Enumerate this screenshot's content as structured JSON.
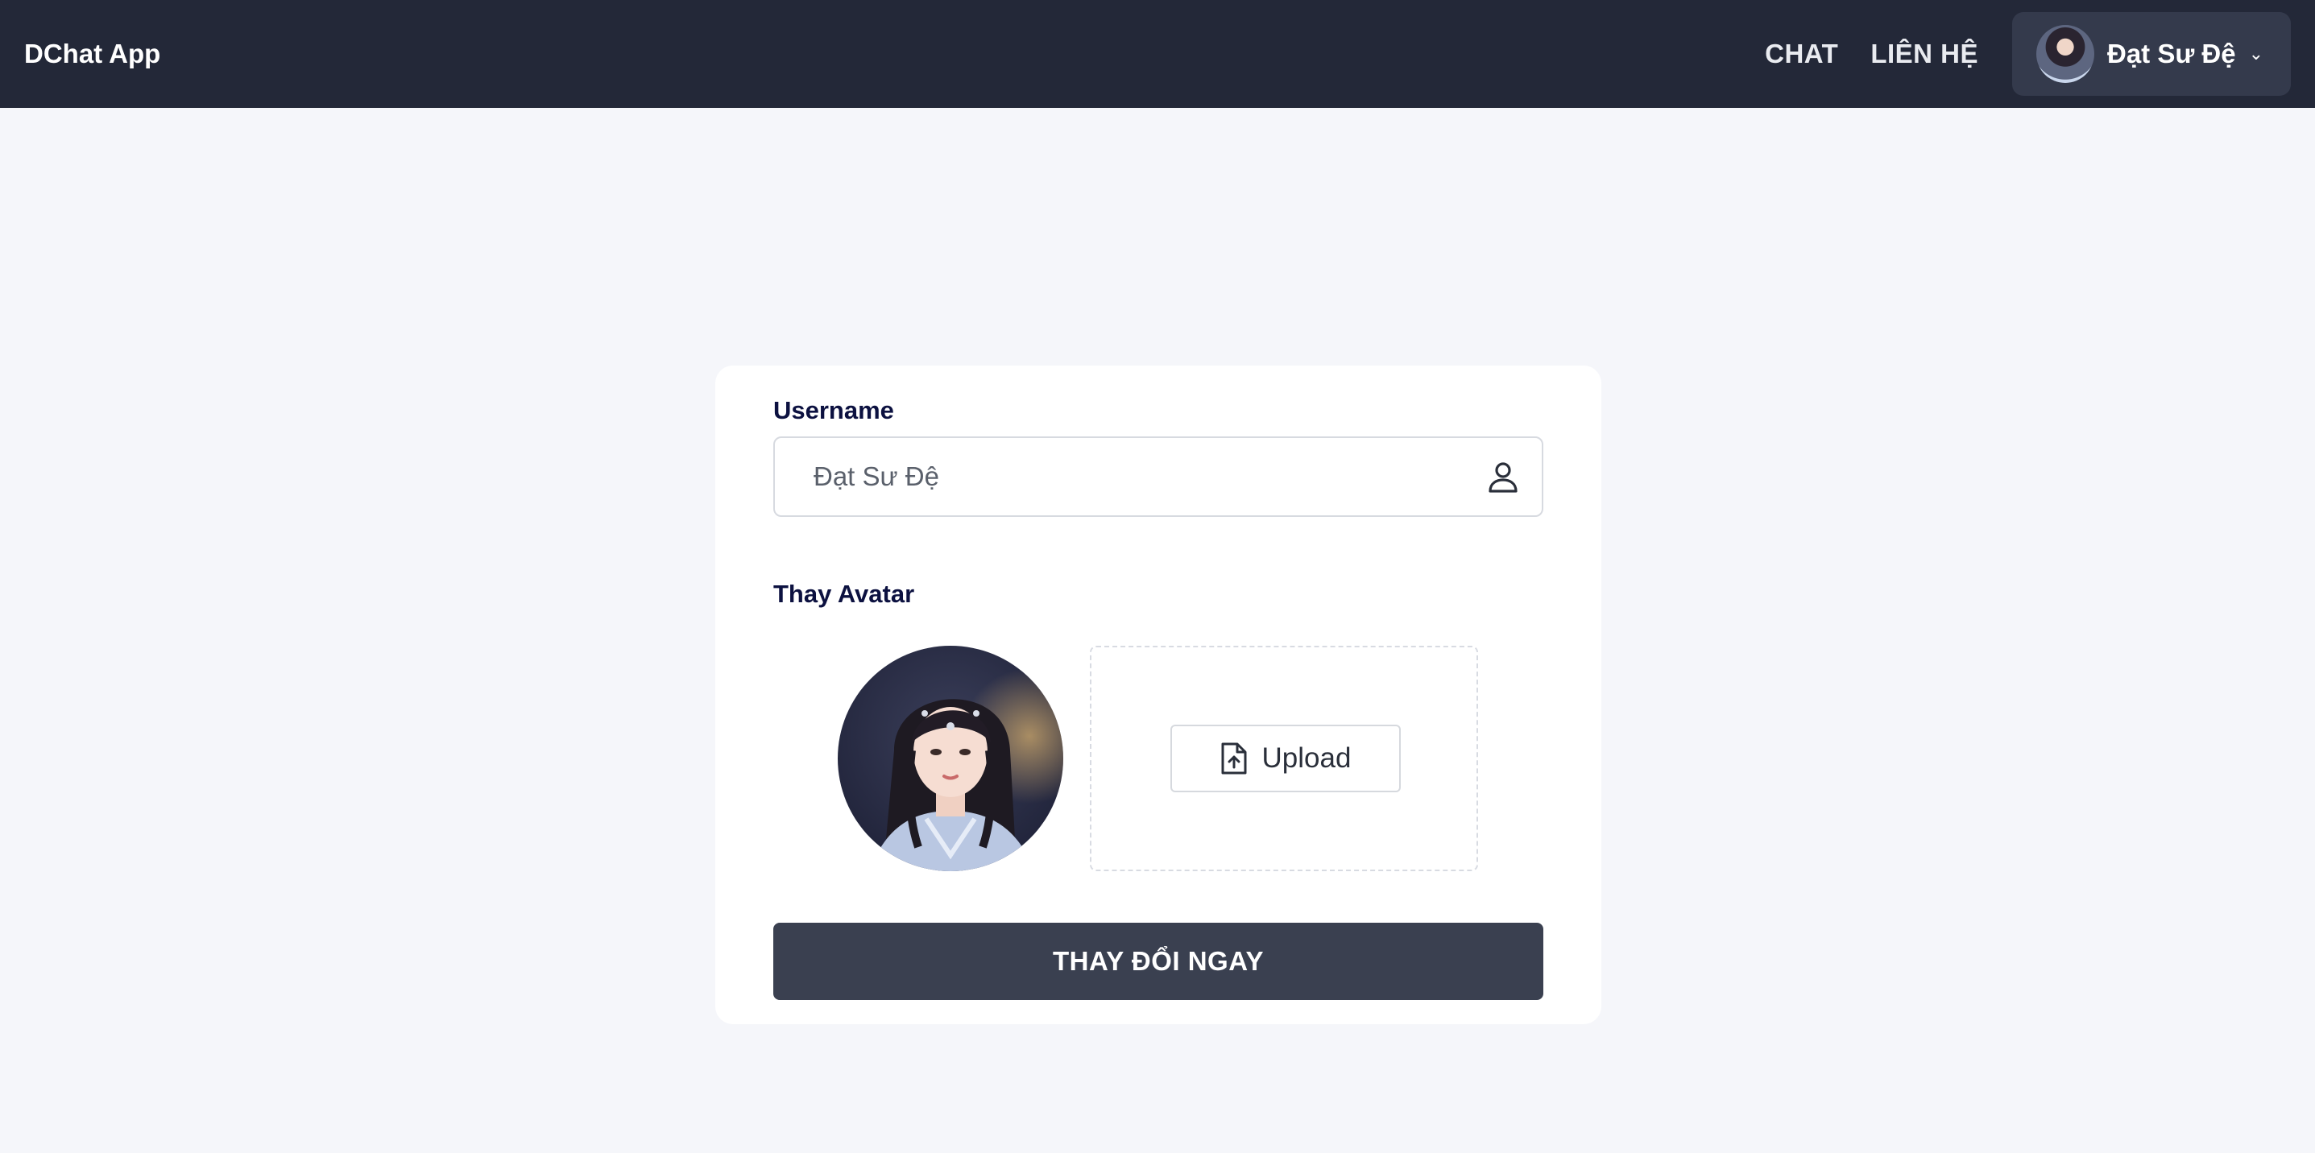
{
  "navbar": {
    "brand": "DChat App",
    "links": [
      "CHAT",
      "LIÊN HỆ"
    ],
    "user_name": "Đạt Sư Đệ",
    "user_menu_icon": "chevron-down-icon"
  },
  "form": {
    "username_label": "Username",
    "username_placeholder": "Đạt Sư Đệ",
    "username_icon": "user-icon",
    "avatar_label": "Thay Avatar",
    "upload_label": "Upload",
    "upload_icon": "file-upload-icon",
    "submit_label": "THAY ĐỔI NGAY"
  },
  "colors": {
    "navbar_bg": "#232838",
    "page_bg": "#f5f6fa",
    "label_text": "#0c1140",
    "submit_bg": "#3a4050"
  }
}
